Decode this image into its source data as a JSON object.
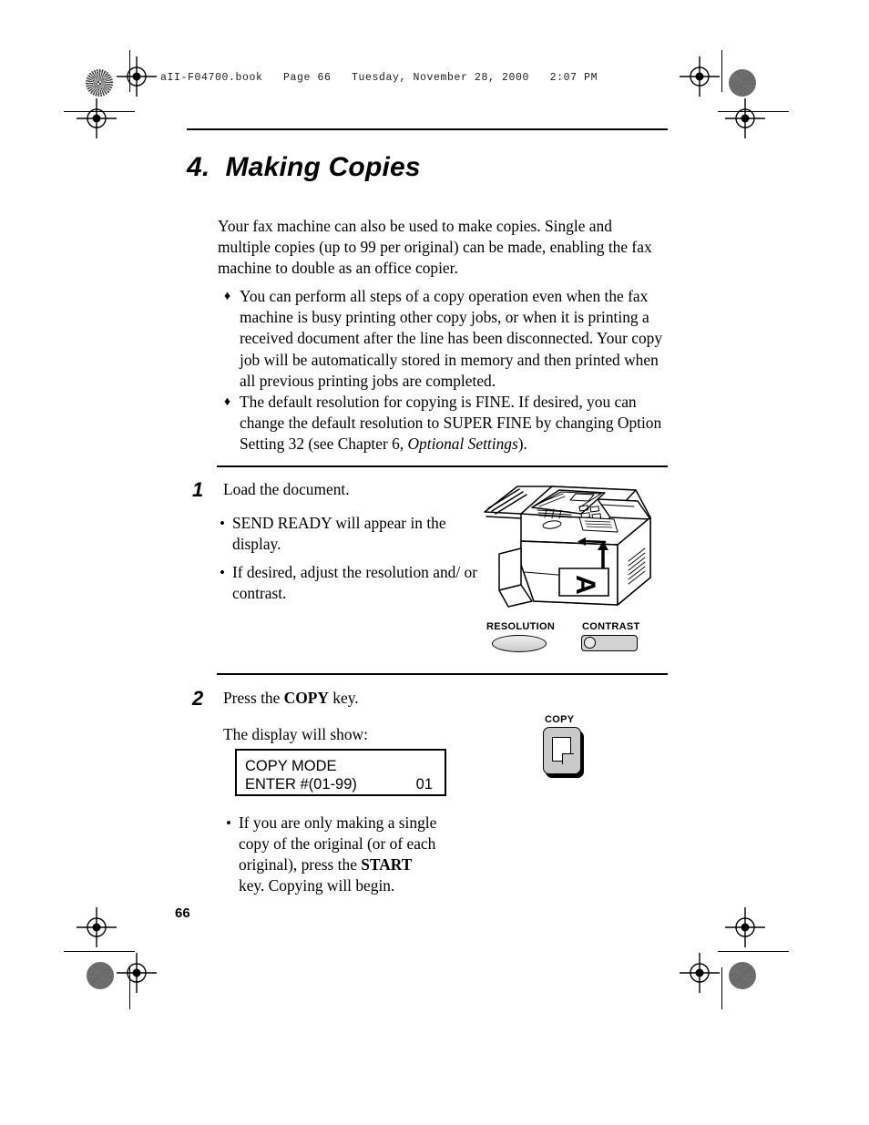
{
  "header": {
    "file_line": "aII-F04700.book   Page 66   Tuesday, November 28, 2000   2:07 PM"
  },
  "chapter": {
    "title": "4.  Making Copies"
  },
  "intro": {
    "text": "Your fax machine can also be used to make copies. Single and multiple copies (up to 99 per original) can be made, enabling the fax machine to double as an office copier."
  },
  "notes": [
    {
      "marker": "♦",
      "text": "You can perform all steps of a copy operation even when the fax machine is busy printing other copy jobs, or when it is printing a received document after the line has been disconnected. Your copy job will be automatically stored in memory and then printed when all previous printing jobs are completed."
    },
    {
      "marker": "♦",
      "text_part1": "The default resolution for copying is FINE. If desired, you can change the default resolution to SUPER FINE by changing Option Setting 32 (see Chapter 6, ",
      "italic": "Optional Settings",
      "text_part2": ")."
    }
  ],
  "steps": [
    {
      "number": "1",
      "lead": "Load the document.",
      "bullets": [
        {
          "marker": "•",
          "text": "SEND READY will appear in the display."
        },
        {
          "marker": "•",
          "text": "If desired, adjust the resolution and/ or contrast."
        }
      ]
    },
    {
      "number": "2",
      "lead_part1": "Press the ",
      "lead_key": "COPY",
      "lead_part2": " key.",
      "display_intro": "The display will show:",
      "bullets": [
        {
          "marker": "•",
          "text_part1": "If you are only making a single copy of the original (or of each original), press the ",
          "key": "START",
          "text_part2": " key. Copying will begin."
        }
      ]
    }
  ],
  "lcd": {
    "line1_left": "COPY MODE",
    "line1_right": "",
    "line2_left": "ENTER #(01-99)",
    "line2_right": "01"
  },
  "hardware": {
    "resolution_label": "RESOLUTION",
    "contrast_label": "CONTRAST",
    "copy_label": "COPY"
  },
  "folio": {
    "page_number": "66"
  }
}
